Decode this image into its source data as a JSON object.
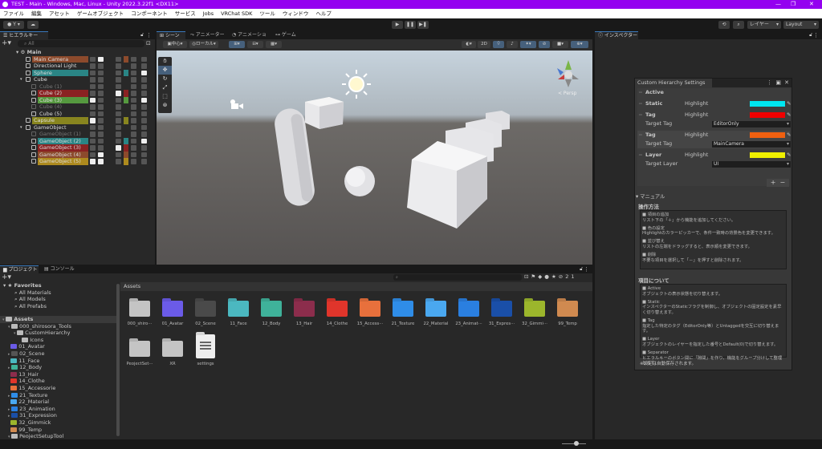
{
  "window": {
    "title": "TEST - Main - Windows, Mac, Linux - Unity 2022.3.22f1 <DX11>"
  },
  "menu": [
    "ファイル",
    "編集",
    "アセット",
    "ゲームオブジェクト",
    "コンポーネント",
    "サービス",
    "Jobs",
    "VRChat SDK",
    "ツール",
    "ウィンドウ",
    "ヘルプ"
  ],
  "toolbar": {
    "account": "Y",
    "layers": "レイヤー",
    "layout": "Layout"
  },
  "hierarchy": {
    "tab": "ヒエラルキー",
    "search_placeholder": "All",
    "scene": "Main",
    "rows": [
      {
        "name": "Main Camera",
        "depth": 1,
        "bg": "#8c4a2c",
        "dim": false
      },
      {
        "name": "Directional Light",
        "depth": 1,
        "bg": "",
        "dim": false
      },
      {
        "name": "Sphere",
        "depth": 1,
        "bg": "#2a8585",
        "dim": false
      },
      {
        "name": "Cube",
        "depth": 1,
        "bg": "",
        "dim": false,
        "fold": true
      },
      {
        "name": "Cube (1)",
        "depth": 2,
        "bg": "",
        "dim": true
      },
      {
        "name": "Cube (2)",
        "depth": 2,
        "bg": "#8a2222",
        "dim": false
      },
      {
        "name": "Cube (3)",
        "depth": 2,
        "bg": "#55993f",
        "dim": false
      },
      {
        "name": "Cube (4)",
        "depth": 2,
        "bg": "",
        "dim": true
      },
      {
        "name": "Cube (5)",
        "depth": 2,
        "bg": "",
        "dim": false
      },
      {
        "name": "Capsule",
        "depth": 1,
        "bg": "#88851f",
        "dim": false
      },
      {
        "name": "GameObject",
        "depth": 1,
        "bg": "",
        "dim": false,
        "fold": true
      },
      {
        "name": "GameObject (1)",
        "depth": 2,
        "bg": "",
        "dim": true
      },
      {
        "name": "GameObject (2)",
        "depth": 2,
        "bg": "#2a8585",
        "dim": false
      },
      {
        "name": "GameObject (3)",
        "depth": 2,
        "bg": "#8a2222",
        "dim": false
      },
      {
        "name": "GameObject (4)",
        "depth": 2,
        "bg": "#8c4a2c",
        "dim": false
      },
      {
        "name": "GameObject (5)",
        "depth": 2,
        "bg": "#ad8a1e",
        "dim": false
      }
    ]
  },
  "scene": {
    "tabs": [
      "シーン",
      "アニメーター",
      "アニメーション",
      "ゲーム"
    ],
    "pivot": "中心",
    "space": "ローカル",
    "mode2d": "2D",
    "persp": "< Persp"
  },
  "inspector": {
    "tab": "インスペクター"
  },
  "chs": {
    "title": "Custom Hierarchy Settings",
    "highlight": "Highlight",
    "items": [
      {
        "label": "Active"
      },
      {
        "label": "Static",
        "color": "#00e5f0"
      },
      {
        "label": "Tag",
        "color": "#f00000",
        "target_label": "Target Tag",
        "target": "EditorOnly"
      },
      {
        "label": "Tag",
        "color": "#f06010",
        "target_label": "Target Tag",
        "target": "MainCamera"
      },
      {
        "label": "Layer",
        "color": "#f0f000",
        "target_label": "Target Layer",
        "target": "UI"
      }
    ],
    "add": "+",
    "remove": "−",
    "manual": "マニュアル",
    "howto_title": "操作方法",
    "howto": [
      [
        "■ 項目の追加",
        "リスト下の「＋」から機能を追加してください。"
      ],
      [
        "■ 色の設定",
        "Highlightのカラーピッカーで、条件一致時の背景色を変更できます。"
      ],
      [
        "■ 並び替え",
        "リストの左端をドラッグすると、表示順を変更できます。"
      ],
      [
        "■ 削除",
        "不要な項目を選択して「－」を押すと削除されます。"
      ]
    ],
    "items_title": "項目について",
    "items_desc": [
      [
        "■ Active",
        "オブジェクトの表示状態を切り替えます。"
      ],
      [
        "■ Static",
        "インスペクターのStaticフラグを制御し、オブジェクトの固定設定を素早く切り替えます。"
      ],
      [
        "■ Tag",
        "指定した特定のタグ（EditorOnly等）とUntaggedを交互に切り替えます。"
      ],
      [
        "■ Layer",
        "オブジェクトのレイヤーを指定した番号とDefault(0)で切り替えます。"
      ],
      [
        "■ Separator",
        "ヒエラルキーのボタン間に「隙間」を作り、機能をグループ分けして整理します。"
      ]
    ],
    "autosave": "※設定は自動保存されます。"
  },
  "project": {
    "tabs": [
      "プロジェクト",
      "コンソール"
    ],
    "hidden_count": "21",
    "breadcrumb": "Assets",
    "favorites": {
      "label": "Favorites",
      "items": [
        "All Materials",
        "All Models",
        "All Prefabs"
      ]
    },
    "tree": [
      {
        "name": "Assets",
        "depth": 0,
        "color": "#bbb",
        "bold": true
      },
      {
        "name": "000_shirosora_Tools",
        "depth": 1,
        "color": "#bbb"
      },
      {
        "name": "CustomHierarchy",
        "depth": 2,
        "color": "#bbb"
      },
      {
        "name": "Icons",
        "depth": 3,
        "color": "#bbb"
      },
      {
        "name": "01_Avatar",
        "depth": 1,
        "color": "#6b5be8"
      },
      {
        "name": "02_Scene",
        "depth": 1,
        "color": "#555"
      },
      {
        "name": "11_Face",
        "depth": 1,
        "color": "#4bb8c0"
      },
      {
        "name": "12_Body",
        "depth": 1,
        "color": "#3fb29a"
      },
      {
        "name": "13_Hair",
        "depth": 1,
        "color": "#8c2d4c"
      },
      {
        "name": "14_Clothe",
        "depth": 1,
        "color": "#e0352b"
      },
      {
        "name": "15_Accessorie",
        "depth": 1,
        "color": "#e8703c"
      },
      {
        "name": "21_Texture",
        "depth": 1,
        "color": "#2f8de8"
      },
      {
        "name": "22_Material",
        "depth": 1,
        "color": "#4aa8f0"
      },
      {
        "name": "23_Animation",
        "depth": 1,
        "color": "#2a7fe0"
      },
      {
        "name": "31_Expression",
        "depth": 1,
        "color": "#1a4fa8"
      },
      {
        "name": "32_Gimmick",
        "depth": 1,
        "color": "#9cb62c"
      },
      {
        "name": "99_Temp",
        "depth": 1,
        "color": "#d08a50"
      },
      {
        "name": "PeojectSetupTool",
        "depth": 1,
        "color": "#bbb"
      }
    ],
    "assets": [
      {
        "name": "000_shiro···",
        "color": "#c4c4c4"
      },
      {
        "name": "01_Avatar",
        "color": "#6b5be8"
      },
      {
        "name": "02_Scene",
        "color": "#4a4a4a"
      },
      {
        "name": "11_Face",
        "color": "#4bb8c0"
      },
      {
        "name": "12_Body",
        "color": "#3fb29a"
      },
      {
        "name": "13_Hair",
        "color": "#8c2d4c"
      },
      {
        "name": "14_Clothe",
        "color": "#e0352b"
      },
      {
        "name": "15_Access···",
        "color": "#e8703c"
      },
      {
        "name": "21_Texture",
        "color": "#2f8de8"
      },
      {
        "name": "22_Material",
        "color": "#4aa8f0"
      },
      {
        "name": "23_Animat···",
        "color": "#2a7fe0"
      },
      {
        "name": "31_Expres···",
        "color": "#1a4fa8"
      },
      {
        "name": "32_Gimmi···",
        "color": "#9cb62c"
      },
      {
        "name": "99_Temp",
        "color": "#d08a50"
      },
      {
        "name": "PeojectSet···",
        "color": "#c4c4c4"
      },
      {
        "name": "XR",
        "color": "#c4c4c4"
      },
      {
        "name": "settings",
        "color": "#eeeeee",
        "file": true
      }
    ]
  }
}
